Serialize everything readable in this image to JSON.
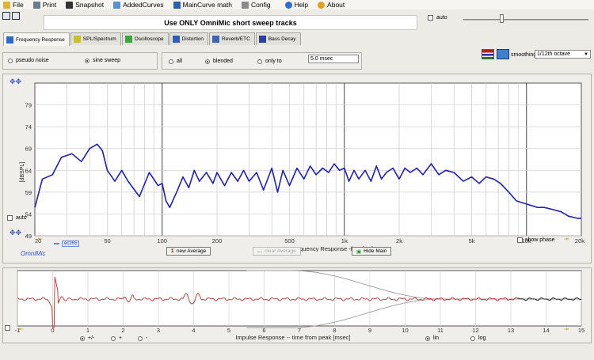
{
  "menu": {
    "file": "File",
    "print": "Print",
    "snapshot": "Snapshot",
    "added_curves": "AddedCurves",
    "maincurve_math": "MainCurve math",
    "config": "Config",
    "help": "Help",
    "about": "About"
  },
  "banner": "Use ONLY OmniMic short sweep tracks",
  "auto_label": "auto",
  "tabs": [
    {
      "label": "Frequency Response",
      "icon": "frequency-response-icon"
    },
    {
      "label": "SPL/Spectrum",
      "icon": "spl-spectrum-icon"
    },
    {
      "label": "Oscilloscope",
      "icon": "oscilloscope-icon"
    },
    {
      "label": "Distortion",
      "icon": "distortion-icon"
    },
    {
      "label": "Reverb/ETC",
      "icon": "reverb-icon"
    },
    {
      "label": "Bass Decay",
      "icon": "bass-decay-icon"
    }
  ],
  "signal": {
    "pseudo_noise": "pseudo noise",
    "sine_sweep": "sine sweep",
    "selected": "sine sweep"
  },
  "gating": {
    "all": "all",
    "blended": "blended",
    "only_to": "only to",
    "selected": "blended",
    "time_value": "5.0 msec"
  },
  "smoothing": {
    "label": "smoothing",
    "value": "1/12th octave"
  },
  "colors": {
    "response_curve": "#1f1fbf",
    "impulse_curve": "#c0312a",
    "impulse_tail": "#111111",
    "window": "#9a9a9a",
    "plot_bg": "#ffffff",
    "accent_red": "#b01010"
  },
  "chart_data": [
    {
      "type": "line",
      "title": "",
      "xlabel": "Frequency Response -freq [Hz]",
      "ylabel": "[dBSPL]",
      "xscale": "log",
      "xlim": [
        20,
        20000
      ],
      "ylim": [
        49,
        84
      ],
      "x_ticks": [
        "20",
        "50",
        "100",
        "200",
        "500",
        "1k",
        "2k",
        "5k",
        "10k",
        "20k"
      ],
      "y_ticks": [
        "79",
        "74",
        "69",
        "64",
        "59",
        "54",
        "49"
      ],
      "grid": "log minor lines",
      "series": [
        {
          "name": "",
          "x": [
            20,
            22,
            25,
            28,
            32,
            36,
            40,
            44,
            47,
            50,
            55,
            60,
            65,
            75,
            85,
            95,
            100,
            105,
            110,
            120,
            130,
            140,
            150,
            160,
            175,
            190,
            200,
            220,
            240,
            260,
            280,
            300,
            330,
            360,
            400,
            430,
            460,
            500,
            550,
            600,
            650,
            700,
            760,
            820,
            880,
            940,
            1000,
            1060,
            1130,
            1200,
            1300,
            1400,
            1500,
            1600,
            1700,
            1850,
            2000,
            2150,
            2300,
            2500,
            2700,
            3000,
            3300,
            3600,
            4000,
            4500,
            5000,
            5500,
            6000,
            6600,
            7200,
            8000,
            8800,
            9600,
            10500,
            11500,
            12500,
            14000,
            15500,
            17000,
            19000,
            20000
          ],
          "y": [
            55.5,
            62,
            63,
            67,
            67.8,
            66,
            69,
            70,
            68.5,
            64,
            61.5,
            64,
            61.5,
            58,
            63.5,
            60.5,
            61,
            57,
            55.5,
            59,
            62.5,
            60,
            64,
            61.5,
            63.5,
            61,
            63.5,
            60.5,
            63.5,
            61.5,
            64,
            61.5,
            63.5,
            59.5,
            64.5,
            59,
            64,
            60.5,
            64.5,
            62,
            65,
            63,
            64.5,
            63.5,
            65.5,
            64,
            64.5,
            61.5,
            64,
            62,
            64,
            61.5,
            65,
            62,
            63.5,
            64.5,
            62,
            64.5,
            63.5,
            64.5,
            63,
            65.5,
            63,
            64,
            63.5,
            61.5,
            62.5,
            61,
            62.5,
            62,
            61,
            59,
            57,
            56.5,
            56,
            55.5,
            55.5,
            55,
            54.5,
            53.5,
            53,
            53
          ]
        }
      ],
      "legend": [
        {
          "name": "ec265"
        }
      ],
      "watermark": "OmniMic",
      "controls": {
        "new_average": "new Average",
        "clear_average": "clear Average",
        "hide_main": "Hide Main",
        "show_phase": "show phase",
        "auto": "auto"
      }
    },
    {
      "type": "line",
      "title": "",
      "xlabel": "Impulse Response  -- time from peak [msec]",
      "ylabel": "",
      "xlim": [
        -1,
        15
      ],
      "x_ticks": [
        "-1",
        "0",
        "1",
        "2",
        "3",
        "4",
        "5",
        "6",
        "7",
        "8",
        "9",
        "10",
        "11",
        "12",
        "13",
        "14",
        "15"
      ],
      "y_ticks": [],
      "grid": "vertical lines",
      "controls": {
        "polarity_both": "+/-",
        "polarity_plus": "+",
        "polarity_minus": "-",
        "lin": "lin",
        "log": "log",
        "selected_scale": "lin"
      }
    }
  ]
}
